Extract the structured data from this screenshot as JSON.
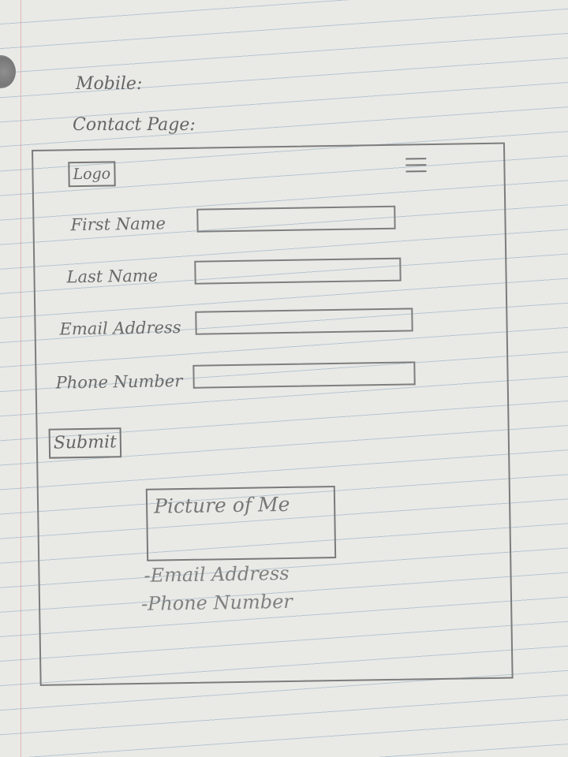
{
  "headings": {
    "mobile": "Mobile:",
    "contact_page": "Contact Page:"
  },
  "header": {
    "logo": "Logo",
    "menu_icon": "hamburger-menu-icon"
  },
  "form": {
    "fields": [
      {
        "label": "First Name",
        "value": ""
      },
      {
        "label": "Last Name",
        "value": ""
      },
      {
        "label": "Email Address",
        "value": ""
      },
      {
        "label": "Phone Number",
        "value": ""
      }
    ],
    "submit_label": "Submit"
  },
  "contact_info": {
    "picture_label": "Picture of Me",
    "email_line": "-Email Address",
    "phone_line": "-Phone Number"
  }
}
